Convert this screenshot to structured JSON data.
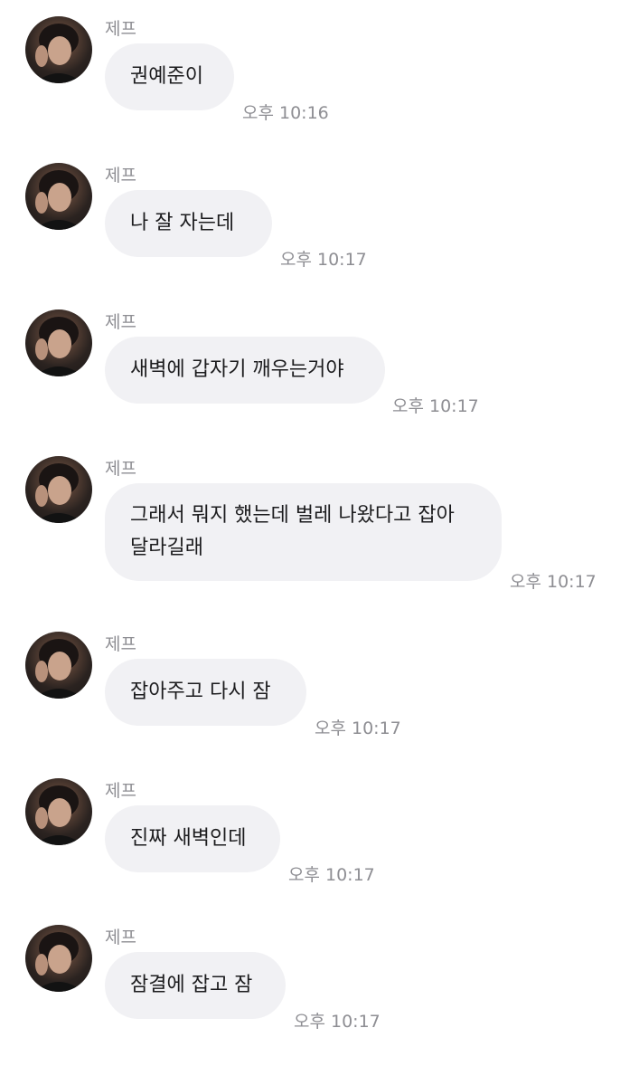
{
  "messages": [
    {
      "sender": "제프",
      "text": "권예준이",
      "time": "오후 10:16"
    },
    {
      "sender": "제프",
      "text": "나 잘 자는데",
      "time": "오후 10:17"
    },
    {
      "sender": "제프",
      "text": "새벽에 갑자기 깨우는거야",
      "time": "오후 10:17"
    },
    {
      "sender": "제프",
      "text": "그래서 뭐지 했는데 벌레 나왔다고 잡아\n달라길래",
      "time": "오후 10:17"
    },
    {
      "sender": "제프",
      "text": "잡아주고 다시 잠",
      "time": "오후 10:17"
    },
    {
      "sender": "제프",
      "text": "진짜 새벽인데",
      "time": "오후 10:17"
    },
    {
      "sender": "제프",
      "text": "잠결에 잡고 잠",
      "time": "오후 10:17"
    }
  ],
  "colors": {
    "bubble": "#f1f1f4",
    "meta_text": "#8e8e93",
    "message_text": "#1c1c1e"
  },
  "icons": {
    "avatar": "profile-photo-avatar"
  }
}
